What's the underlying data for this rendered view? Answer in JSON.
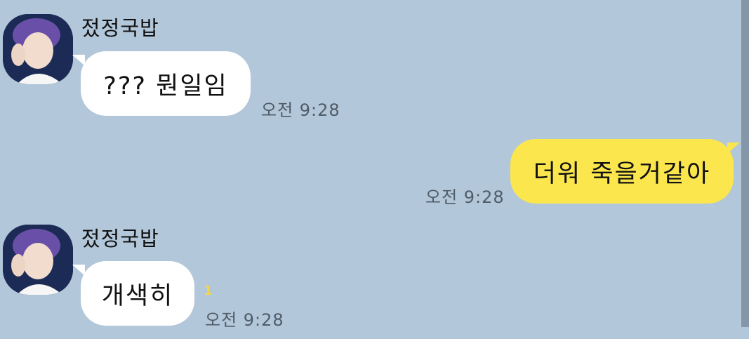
{
  "messages": [
    {
      "sender": "젔정국밥",
      "text": "??? 뭔일임",
      "time": "오전 9:28",
      "direction": "incoming"
    },
    {
      "text": "더워 죽을거같아",
      "time": "오전 9:28",
      "direction": "outgoing"
    },
    {
      "sender": "젔정국밥",
      "text": "개색히",
      "time": "오전 9:28",
      "unread": "1",
      "direction": "incoming"
    }
  ],
  "colors": {
    "background": "#b2c7d9",
    "incoming_bubble": "#ffffff",
    "outgoing_bubble": "#fbe64d",
    "unread": "#f2d64a"
  },
  "icons": {
    "avatar": "profile-photo"
  }
}
